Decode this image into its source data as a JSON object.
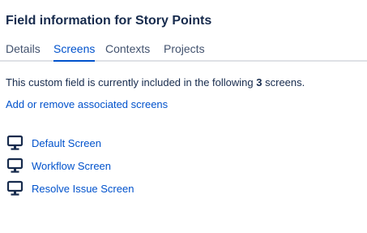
{
  "title": "Field information for Story Points",
  "tabs": [
    {
      "label": "Details",
      "active": false
    },
    {
      "label": "Screens",
      "active": true
    },
    {
      "label": "Contexts",
      "active": false
    },
    {
      "label": "Projects",
      "active": false
    }
  ],
  "description": {
    "prefix": "This custom field is currently included in the following ",
    "count": "3",
    "suffix": " screens."
  },
  "manage_link": "Add or remove associated screens",
  "screens": [
    {
      "label": "Default Screen",
      "icon": "monitor-icon"
    },
    {
      "label": "Workflow Screen",
      "icon": "monitor-icon"
    },
    {
      "label": "Resolve Issue Screen",
      "icon": "monitor-icon"
    }
  ],
  "colors": {
    "link": "#0052cc",
    "text": "#172b4d",
    "tab_inactive": "#42526e",
    "divider": "#dfe1e6"
  }
}
